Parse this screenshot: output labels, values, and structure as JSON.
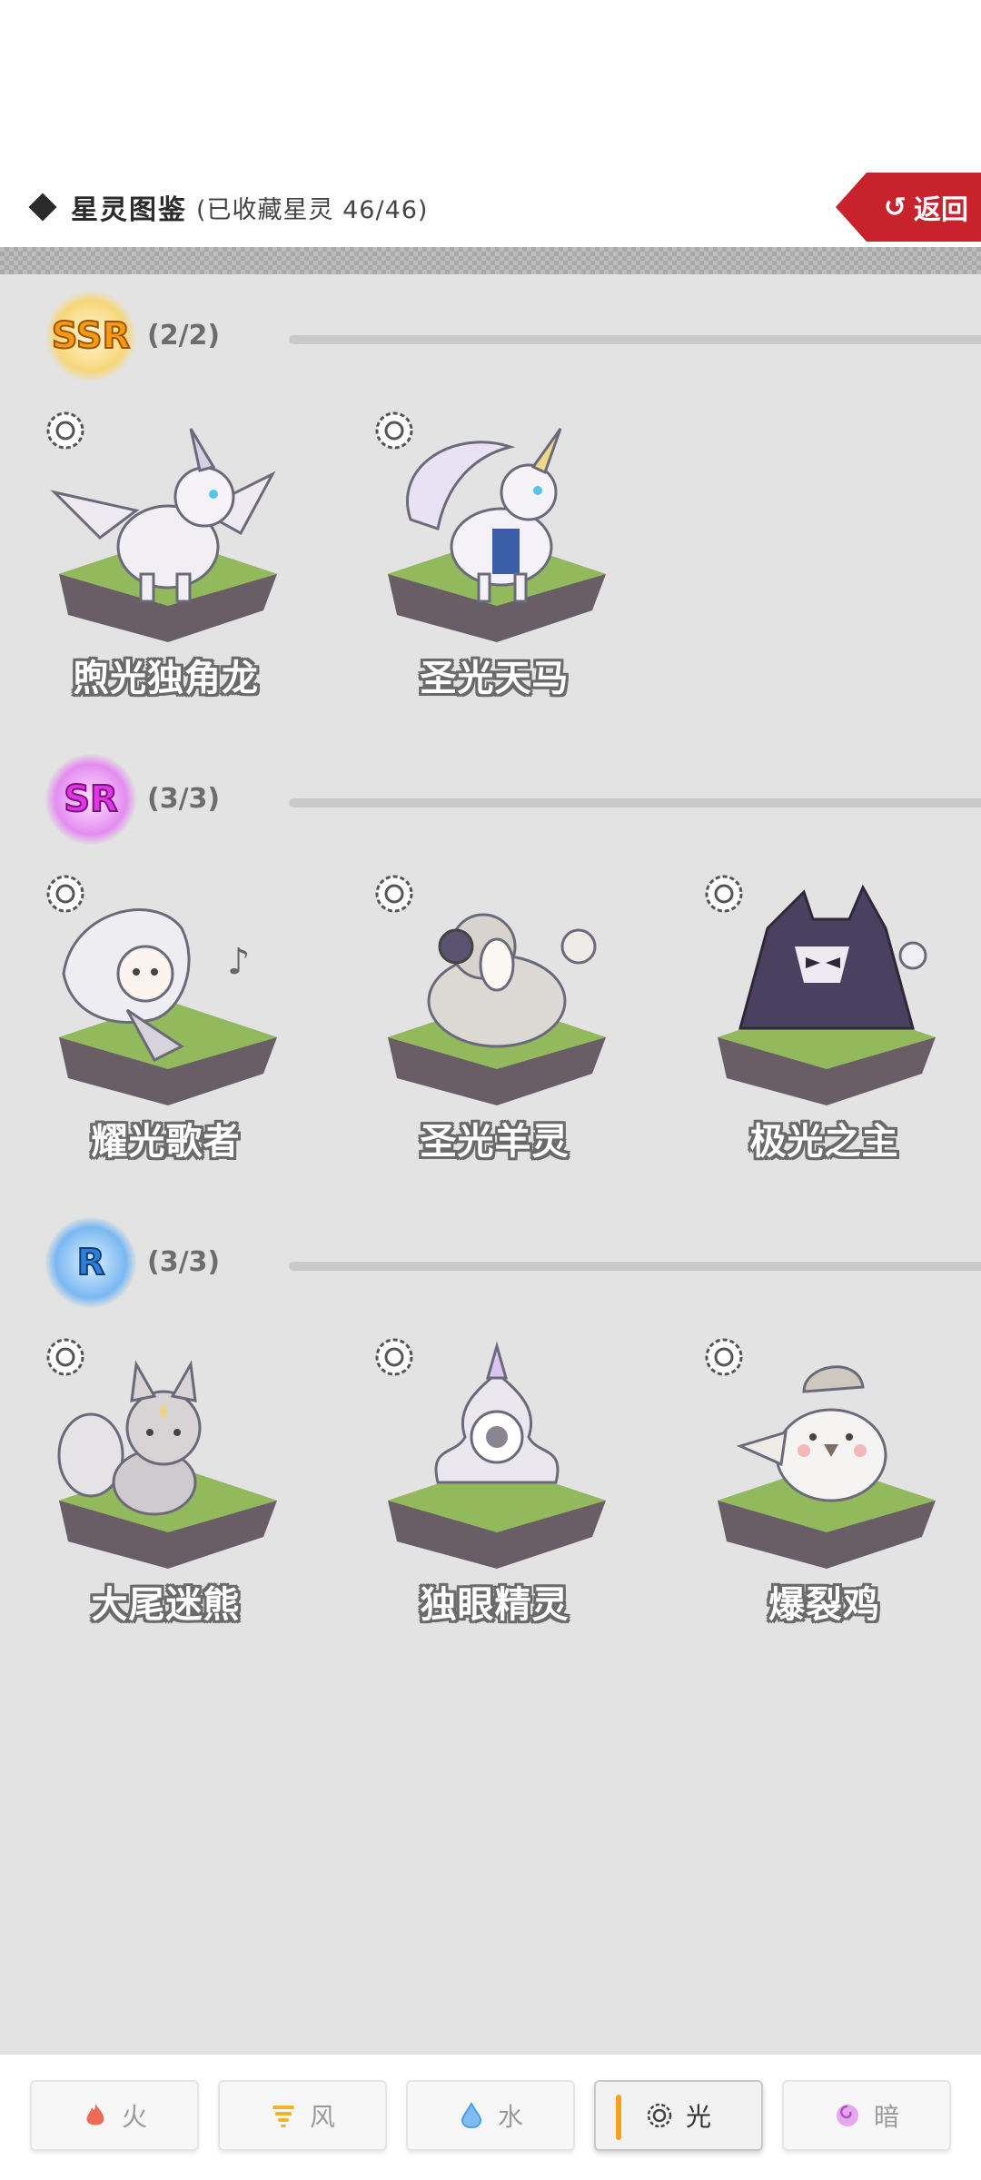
{
  "header": {
    "title": "星灵图鉴",
    "collected": "(已收藏星灵 46/46)",
    "back_label": "返回"
  },
  "sections": [
    {
      "rarity": "SSR",
      "count": "(2/2)",
      "badge_color": "#f5a623",
      "items": [
        {
          "name": "煦光独角龙",
          "icon": "dragon-creature"
        },
        {
          "name": "圣光天马",
          "icon": "pegasus-creature"
        }
      ]
    },
    {
      "rarity": "SR",
      "count": "(3/3)",
      "badge_color": "#d63fd8",
      "items": [
        {
          "name": "耀光歌者",
          "icon": "singer-creature"
        },
        {
          "name": "圣光羊灵",
          "icon": "sheep-creature"
        },
        {
          "name": "极光之主",
          "icon": "dark-lord-creature"
        }
      ]
    },
    {
      "rarity": "R",
      "count": "(3/3)",
      "badge_color": "#3b8fe6",
      "items": [
        {
          "name": "大尾迷熊",
          "icon": "bear-creature"
        },
        {
          "name": "独眼精灵",
          "icon": "one-eye-creature"
        },
        {
          "name": "爆裂鸡",
          "icon": "chick-creature"
        }
      ]
    }
  ],
  "element_icon": "sun-icon",
  "tabs": [
    {
      "label": "火",
      "icon": "flame-icon",
      "color": "#e8553e",
      "active": false
    },
    {
      "label": "风",
      "icon": "tornado-icon",
      "color": "#f0b429",
      "active": false
    },
    {
      "label": "水",
      "icon": "water-drop-icon",
      "color": "#4a9fe8",
      "active": false
    },
    {
      "label": "光",
      "icon": "sun-icon",
      "color": "#444444",
      "active": true
    },
    {
      "label": "暗",
      "icon": "swirl-icon",
      "color": "#c76ad8",
      "active": false
    }
  ],
  "colors": {
    "back_button": "#c8232c",
    "content_bg": "#e3e3e3",
    "grass": "#93b95d",
    "active_tab_accent": "#f3a21c"
  }
}
